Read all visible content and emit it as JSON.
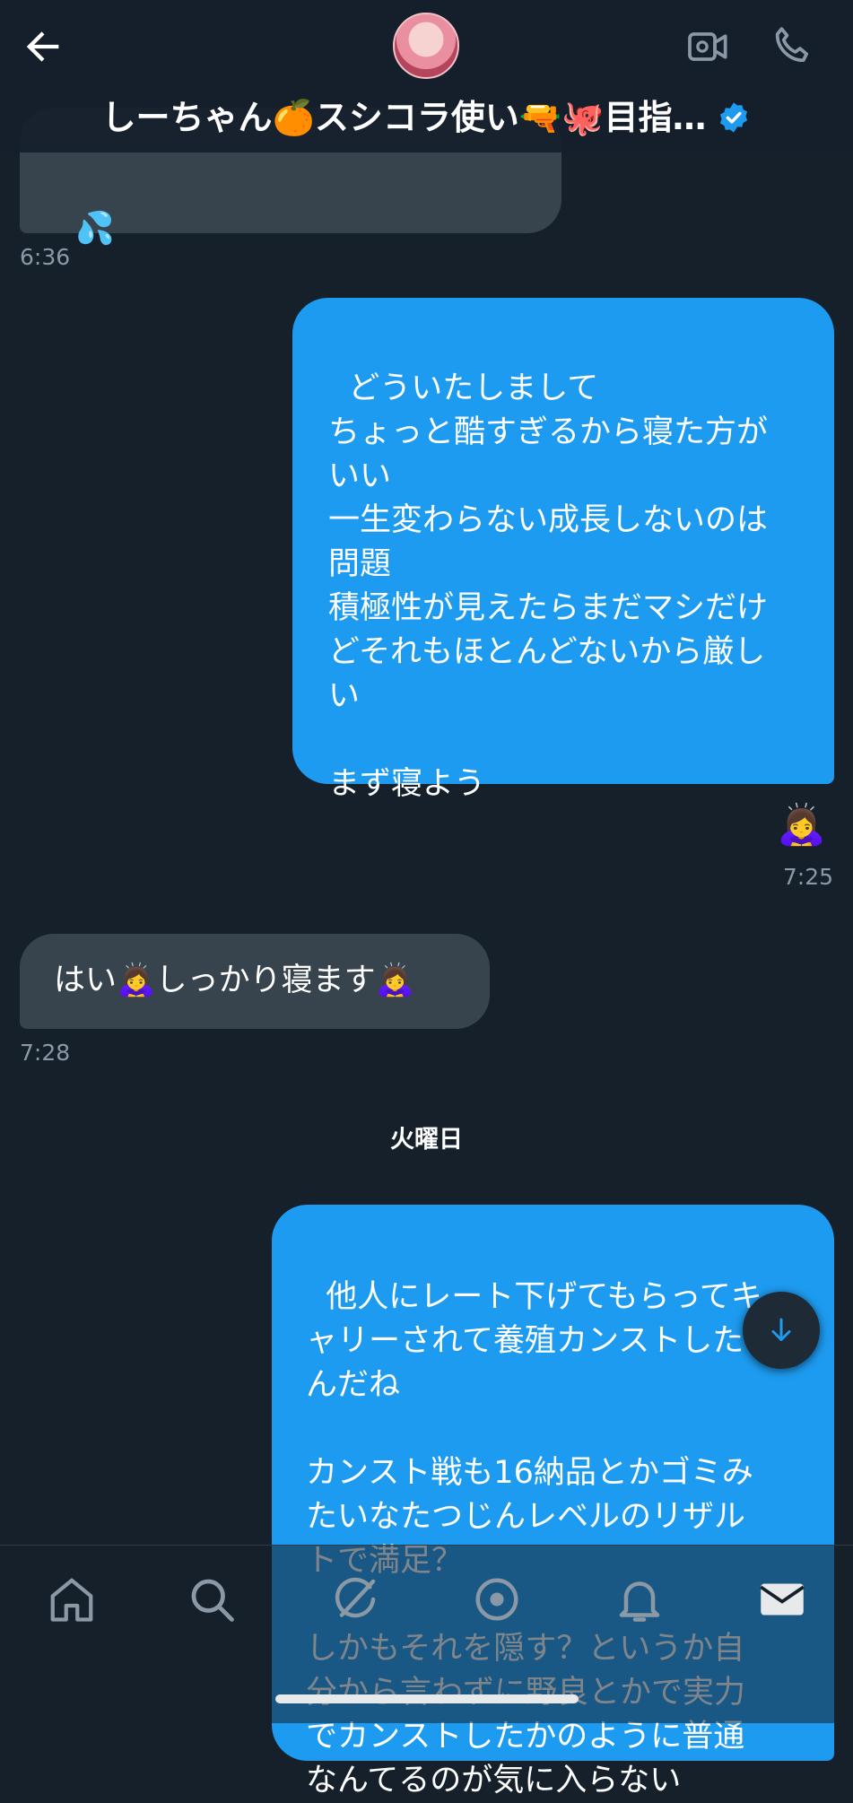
{
  "header": {
    "title": "しーちゃん🍊スシコラ使い🔫🐙目指…",
    "verified": true
  },
  "messages": [
    {
      "id": "m1",
      "direction": "incoming",
      "text": "💦",
      "time": "6:36"
    },
    {
      "id": "m2",
      "direction": "outgoing",
      "text": "どういたしまして\nちょっと酷すぎるから寝た方が\nいい\n一生変わらない成長しないのは\n問題\n積極性が見えたらまだマシだけ\nどそれもほとんどないから厳し\nい\n\nまず寝よう",
      "reaction": "🙇‍♀️",
      "time": "7:25"
    },
    {
      "id": "m3",
      "direction": "incoming",
      "text": "はい🙇‍♀️しっかり寝ます🙇‍♀️",
      "time": "7:28"
    },
    {
      "id": "m4",
      "direction": "outgoing",
      "text": "他人にレート下げてもらってキ\nャリーされて養殖カンストした\nんだね\n\nカンスト戦も16納品とかゴミみ\nたいなたつじんレベルのリザル\nトで満足？\n\nしかもそれを隠す？というか自\n分から言わずに野良とかで実力\nでカンストしたかのように普通\nなんてるのが気に入らない"
    }
  ],
  "day_separator": "火曜日",
  "nav": {
    "tabs": [
      "home",
      "search",
      "grok",
      "communities",
      "notifications",
      "messages"
    ],
    "active": "messages"
  },
  "colors": {
    "background": "#15202b",
    "incoming_bubble": "#38444d",
    "outgoing_bubble": "#1d9bf0",
    "timestamp": "#8b98a5"
  }
}
